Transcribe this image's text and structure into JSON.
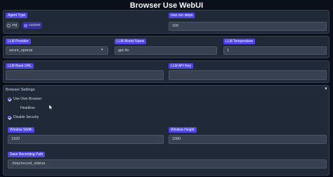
{
  "app": {
    "title": "Browser Use WebUI"
  },
  "agent": {
    "type_label": "Agent Type",
    "options": [
      "org",
      "custom"
    ],
    "selected": "custom",
    "max_steps_label": "max run steps",
    "max_steps_value": "100"
  },
  "llm": {
    "provider_label": "LLM Provider",
    "provider_value": "azure_openai",
    "model_label": "LLM Model Name",
    "model_value": "gpt-4o",
    "temperature_label": "LLM Temperature",
    "temperature_value": "1",
    "base_url_label": "LLM Base URL",
    "base_url_value": "",
    "api_key_label": "LLM API Key",
    "api_key_value": ""
  },
  "browser": {
    "section_label": "Browser Settings",
    "use_own_label": "Use Own Browser",
    "use_own_checked": true,
    "headless_label": "Headless",
    "headless_checked": false,
    "disable_security_label": "Disable Security",
    "disable_security_checked": true,
    "window_width_label": "Window Width",
    "window_width_value": "1920",
    "window_height_label": "Window Height",
    "window_height_value": "1080",
    "recording_label": "Save Recording Path",
    "recording_value": "./tmp/record_videos"
  },
  "colors": {
    "accent": "#4f46e5",
    "background": "#0b0f19",
    "panel": "#1f2937"
  }
}
